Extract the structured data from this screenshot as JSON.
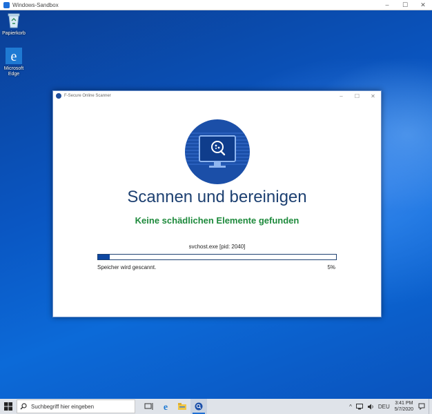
{
  "sandbox": {
    "title": "Windows-Sandbox",
    "controls": [
      "–",
      "☐",
      "✕"
    ]
  },
  "desktop": {
    "icons": [
      {
        "label": "Papierkorb",
        "icon": "recycle-bin-icon"
      },
      {
        "label": "Microsoft Edge",
        "icon": "edge-icon"
      }
    ]
  },
  "app": {
    "title": "F-Secure Online Scanner",
    "controls": [
      "–",
      "☐",
      "✕"
    ],
    "heading": "Scannen und bereinigen",
    "status": "Keine schädlichen Elemente gefunden",
    "process": "svchost.exe [pid: 2040]",
    "progress_label": "Speicher wird gescannt.",
    "progress_percent_text": "5%",
    "progress_fraction": 0.05,
    "accent": "#0d47a1",
    "status_color": "#1e8a3c"
  },
  "taskbar": {
    "search_placeholder": "Suchbegriff hier eingeben",
    "apps": [
      "task-view-icon",
      "edge-icon",
      "file-explorer-icon",
      "f-secure-icon"
    ],
    "tray": {
      "language": "DEU",
      "time": "3:41 PM",
      "date": "5/7/2020"
    }
  }
}
